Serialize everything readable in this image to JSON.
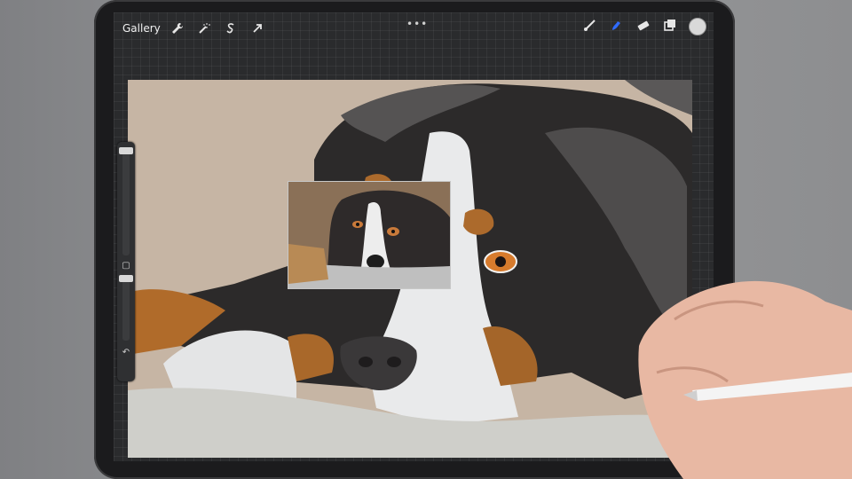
{
  "toolbar": {
    "gallery_label": "Gallery",
    "left_icons": [
      "wrench-icon",
      "magic-wand-icon",
      "selection-s-icon",
      "move-arrow-icon"
    ],
    "right_icons": [
      "brush-icon",
      "smudge-icon",
      "eraser-icon",
      "layers-icon"
    ],
    "more_label": "•••",
    "active_color": "#d9d9d9",
    "active_tool_color": "#2f6bff"
  },
  "sidebar": {
    "modify_label": "▢",
    "undo_label": "↶"
  },
  "colors": {
    "background": "#c8b7a6",
    "fur_black": "#2b2929",
    "fur_gray": "#535151",
    "fur_white": "#e8e9ea",
    "tan": "#b06b2a",
    "floor": "#cfcfcb"
  }
}
